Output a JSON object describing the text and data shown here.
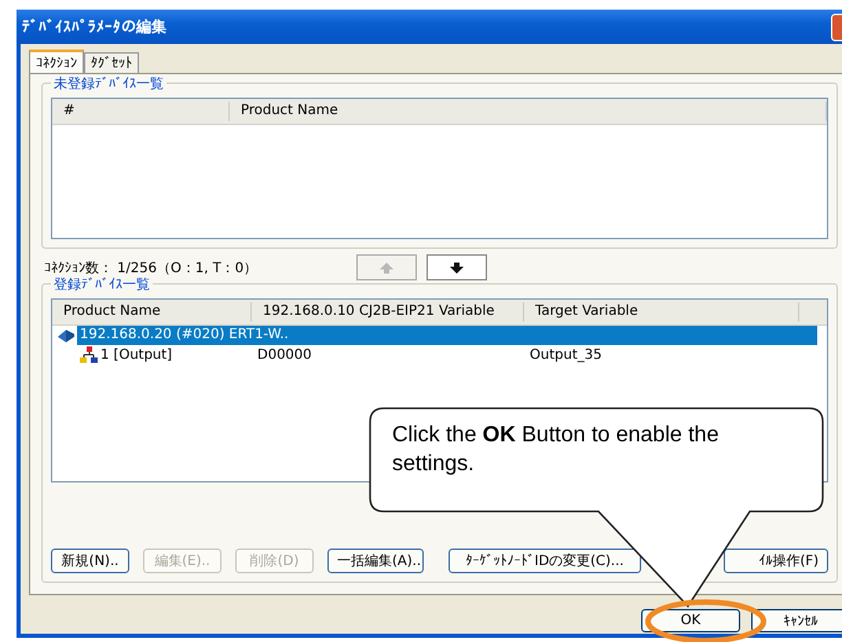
{
  "window": {
    "title": "ﾃﾞﾊﾞｲｽﾊﾟﾗﾒｰﾀの編集"
  },
  "tabs": [
    {
      "label": "ｺﾈｸｼｮﾝ",
      "selected": true
    },
    {
      "label": "ﾀｸﾞｾｯﾄ",
      "selected": false
    }
  ],
  "unregistered": {
    "title": "未登録ﾃﾞﾊﾞｲｽ一覧",
    "columns": [
      "#",
      "Product Name"
    ]
  },
  "connection_count": "ｺﾈｸｼｮﾝ数： 1/256（O：1, T：0）",
  "move_buttons": [
    {
      "kind": "up",
      "disabled": true
    },
    {
      "kind": "down",
      "disabled": false
    }
  ],
  "registered": {
    "title": "登録ﾃﾞﾊﾞｲｽ一覧",
    "columns": [
      "Product Name",
      "192.168.0.10 CJ2B-EIP21 Variable",
      "Target Variable"
    ],
    "rows": [
      {
        "label": "192.168.0.20 (#020) ERT1-W..",
        "selected": true,
        "children": [
          {
            "label": "1 [Output]",
            "cells": [
              "D00000",
              "Output_35"
            ]
          }
        ]
      }
    ]
  },
  "action_buttons": [
    {
      "label": "新規(N)..",
      "disabled": false
    },
    {
      "label": "編集(E)..",
      "disabled": true
    },
    {
      "label": "削除(D)",
      "disabled": true
    },
    {
      "label": "一括編集(A)..",
      "disabled": false
    },
    {
      "label": "ﾀｰｹﾞｯﾄﾉｰﾄﾞIDの変更(C)...",
      "disabled": false
    },
    {
      "label": "ｲﾙ操作(F)",
      "disabled": false
    }
  ],
  "dialog_buttons": [
    {
      "label": "OK",
      "highlighted": true
    },
    {
      "label": "ｷｬﾝｾﾙ",
      "highlighted": false
    }
  ],
  "callout": {
    "text": "Click the **OK** Button to enable the settings."
  }
}
